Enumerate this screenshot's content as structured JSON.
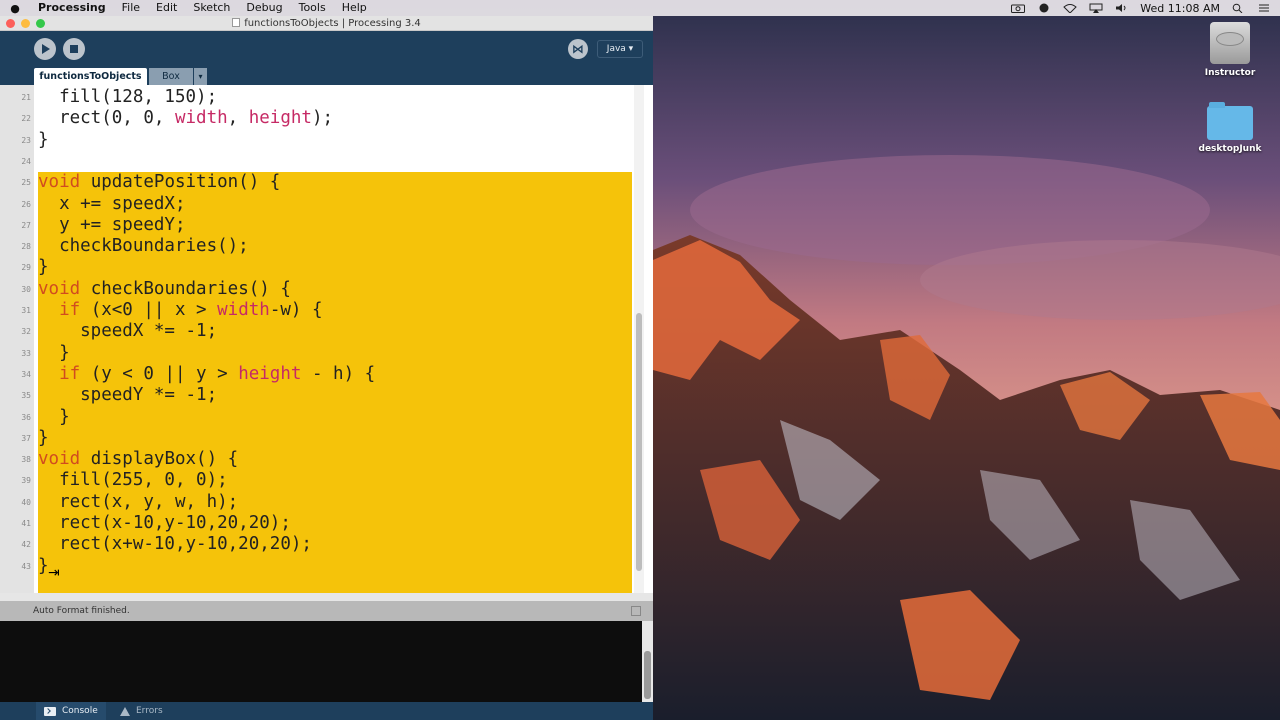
{
  "menubar": {
    "app_name": "Processing",
    "menus": [
      "File",
      "Edit",
      "Sketch",
      "Debug",
      "Tools",
      "Help"
    ],
    "clock": "Wed 11:08 AM"
  },
  "window": {
    "title": "functionsToObjects | Processing 3.4"
  },
  "toolbar": {
    "run_icon": "play-icon",
    "stop_icon": "stop-icon",
    "debug_icon": "butterfly-icon",
    "mode_label": "Java ▾"
  },
  "tabs": {
    "active_label": "functionsToObjects",
    "second_label": "Box",
    "menu_glyph": "▾"
  },
  "editor": {
    "lines": [
      {
        "n": "21",
        "html": "  fill(128, 150);"
      },
      {
        "n": "22",
        "html": "  rect(0, 0, width, height);"
      },
      {
        "n": "23",
        "html": "}"
      },
      {
        "n": "24",
        "html": ""
      },
      {
        "n": "25",
        "html": "void updatePosition() {"
      },
      {
        "n": "26",
        "html": "  x += speedX;"
      },
      {
        "n": "27",
        "html": "  y += speedY;"
      },
      {
        "n": "28",
        "html": "  checkBoundaries();"
      },
      {
        "n": "29",
        "html": "}"
      },
      {
        "n": "30",
        "html": "void checkBoundaries() {"
      },
      {
        "n": "31",
        "html": "  if (x<0 || x > width-w) {"
      },
      {
        "n": "32",
        "html": "    speedX *= -1;"
      },
      {
        "n": "33",
        "html": "  }"
      },
      {
        "n": "34",
        "html": "  if (y < 0 || y > height - h) {"
      },
      {
        "n": "35",
        "html": "    speedY *= -1;"
      },
      {
        "n": "36",
        "html": "  }"
      },
      {
        "n": "37",
        "html": "}"
      },
      {
        "n": "38",
        "html": "void displayBox() {"
      },
      {
        "n": "39",
        "html": "  fill(255, 0, 0);"
      },
      {
        "n": "40",
        "html": "  rect(x, y, w, h);"
      },
      {
        "n": "41",
        "html": "  rect(x-10,y-10,20,20);"
      },
      {
        "n": "42",
        "html": "  rect(x+w-10,y-10,20,20);"
      },
      {
        "n": "43",
        "html": "}"
      }
    ],
    "highlight_color": "#f5c30a"
  },
  "status": {
    "message": "Auto Format finished."
  },
  "bottom_tabs": {
    "console_label": "Console",
    "errors_label": "Errors"
  },
  "desktop": {
    "icons": [
      {
        "label": "Instructor",
        "icon": "hard-drive-icon"
      },
      {
        "label": "desktopJunk",
        "icon": "folder-icon"
      }
    ]
  },
  "colors": {
    "toolbar": "#1e3f5c",
    "keyword": "#d14c1f",
    "builtin_var": "#c62a65"
  }
}
